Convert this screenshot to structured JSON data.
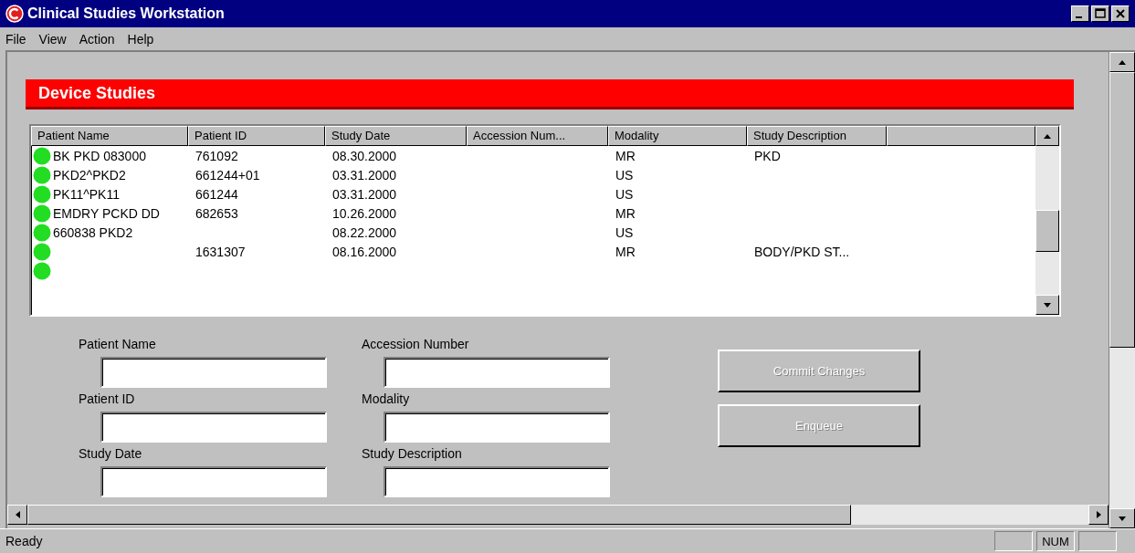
{
  "window": {
    "title": "Clinical Studies Workstation"
  },
  "menu": [
    "File",
    "View",
    "Action",
    "Help"
  ],
  "panel_title": "Device Studies",
  "table": {
    "columns": [
      "Patient Name",
      "Patient ID",
      "Study Date",
      "Accession Num...",
      "Modality",
      "Study Description"
    ],
    "rows": [
      {
        "cells": [
          "BK PKD 083000",
          "761092",
          "08.30.2000",
          "",
          "MR",
          "PKD"
        ]
      },
      {
        "cells": [
          "PKD2^PKD2",
          "661244+01",
          "03.31.2000",
          "",
          "US",
          ""
        ]
      },
      {
        "cells": [
          "PK11^PK11",
          "661244",
          "03.31.2000",
          "",
          "US",
          ""
        ]
      },
      {
        "cells": [
          "EMDRY PCKD DD",
          "682653",
          "10.26.2000",
          "",
          "MR",
          ""
        ]
      },
      {
        "cells": [
          "660838 PKD2",
          "",
          "08.22.2000",
          "",
          "US",
          ""
        ]
      },
      {
        "cells": [
          "",
          "1631307",
          "08.16.2000",
          "",
          "MR",
          "BODY/PKD ST..."
        ]
      }
    ]
  },
  "fields": [
    {
      "label": "Patient Name"
    },
    {
      "label": "Accession Number"
    },
    {
      "label": "Patient ID"
    },
    {
      "label": "Modality"
    },
    {
      "label": "Study Date"
    },
    {
      "label": "Study Description"
    }
  ],
  "buttons": [
    {
      "label": "Commit Changes",
      "disabled": true
    },
    {
      "label": "Enqueue",
      "disabled": true
    }
  ],
  "status_bar": {
    "message": "Ready",
    "indicator": "NUM"
  }
}
